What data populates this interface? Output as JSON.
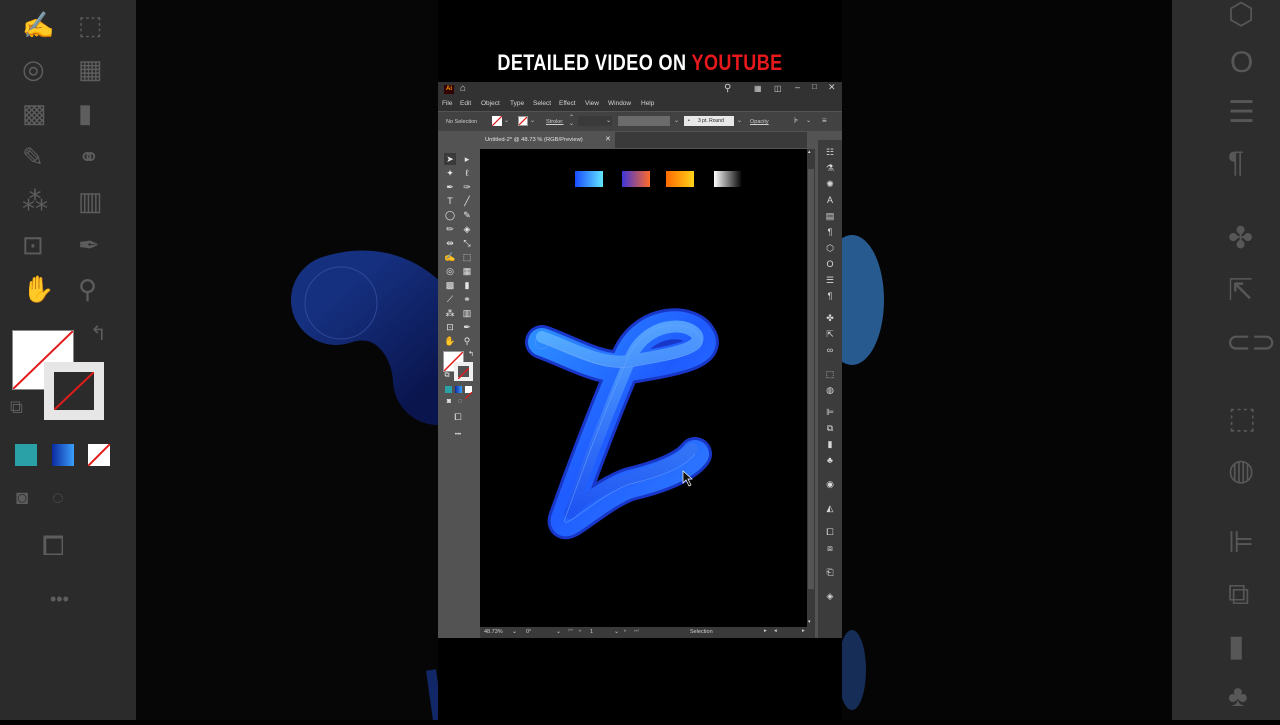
{
  "overlay": {
    "headline_prefix": "DETAILED VIDEO ON ",
    "headline_highlight": "YOUTUBE"
  },
  "app": {
    "logo": "Ai",
    "menu": [
      "File",
      "Edit",
      "Object",
      "Type",
      "Select",
      "Effect",
      "View",
      "Window",
      "Help"
    ],
    "control_bar": {
      "selection_state": "No Selection",
      "stroke_label": "Stroke:",
      "brush_label": "3 pt. Round",
      "opacity_label": "Opacity"
    },
    "document_tab": "Untitled-2* @ 48.73 % (RGB/Preview)",
    "status": {
      "zoom": "48.73%",
      "rotation": "0°",
      "artboard_number": "1",
      "active_tool": "Selection"
    }
  },
  "canvas": {
    "artwork": "cursive L with blue gradient tube stroke",
    "gradient_swatches": [
      {
        "name": "blue-cyan",
        "from": "#1a4cff",
        "to": "#62e6ff"
      },
      {
        "name": "purple-orange",
        "from": "#3d35d8",
        "to": "#ff6a2a"
      },
      {
        "name": "orange-yellow",
        "from": "#ff6a00",
        "to": "#ffd21a"
      },
      {
        "name": "white-black",
        "from": "#ffffff",
        "to": "#000000"
      }
    ]
  },
  "colors": {
    "accent_red": "#e8191c",
    "ui_dark": "#323232",
    "ui_mid": "#535353"
  }
}
